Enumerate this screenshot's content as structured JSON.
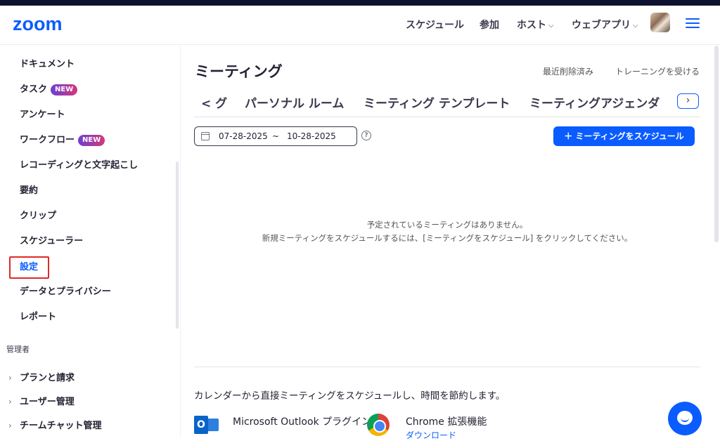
{
  "header": {
    "logo": "zoom",
    "nav": {
      "schedule": "スケジュール",
      "join": "参加",
      "host": "ホスト",
      "webapp": "ウェブアプリ"
    }
  },
  "sidebar": {
    "items": [
      {
        "label": "ドキュメント"
      },
      {
        "label": "タスク",
        "badge": "NEW"
      },
      {
        "label": "アンケート"
      },
      {
        "label": "ワークフロー",
        "badge": "NEW"
      },
      {
        "label": "レコーディングと文字起こし"
      },
      {
        "label": "要約"
      },
      {
        "label": "クリップ"
      },
      {
        "label": "スケジューラー"
      },
      {
        "label": "設定",
        "active": true
      },
      {
        "label": "データとプライバシー"
      },
      {
        "label": "レポート"
      }
    ],
    "admin_section": "管理者",
    "admin_items": [
      {
        "label": "プランと請求"
      },
      {
        "label": "ユーザー管理"
      },
      {
        "label": "チームチャット管理"
      }
    ]
  },
  "main": {
    "title": "ミーティング",
    "links": {
      "recently_deleted": "最近削除済み",
      "training": "トレーニングを受ける"
    },
    "tabs": [
      {
        "label": "< グ"
      },
      {
        "label": "パーソナル ルーム"
      },
      {
        "label": "ミーティング テンプレート"
      },
      {
        "label": "ミーティングアジェンダ"
      }
    ],
    "date_range": {
      "start": "07-28-2025",
      "separator": "~",
      "end": "10-28-2025"
    },
    "schedule_button": "＋ ミーティングをスケジュール",
    "empty_line1": "予定されているミーティングはありません。",
    "empty_line2": "新規ミーティングをスケジュールするには、[ミーティングをスケジュール] をクリックしてください。",
    "promo": "カレンダーから直接ミーティングをスケジュールし、時間を節約します。",
    "extensions": {
      "outlook_title": "Microsoft Outlook プラグイン",
      "chrome_title": "Chrome 拡張機能",
      "chrome_link": "ダウンロード"
    }
  },
  "colors": {
    "accent": "#0b5cff",
    "active_outline": "#e02828"
  }
}
